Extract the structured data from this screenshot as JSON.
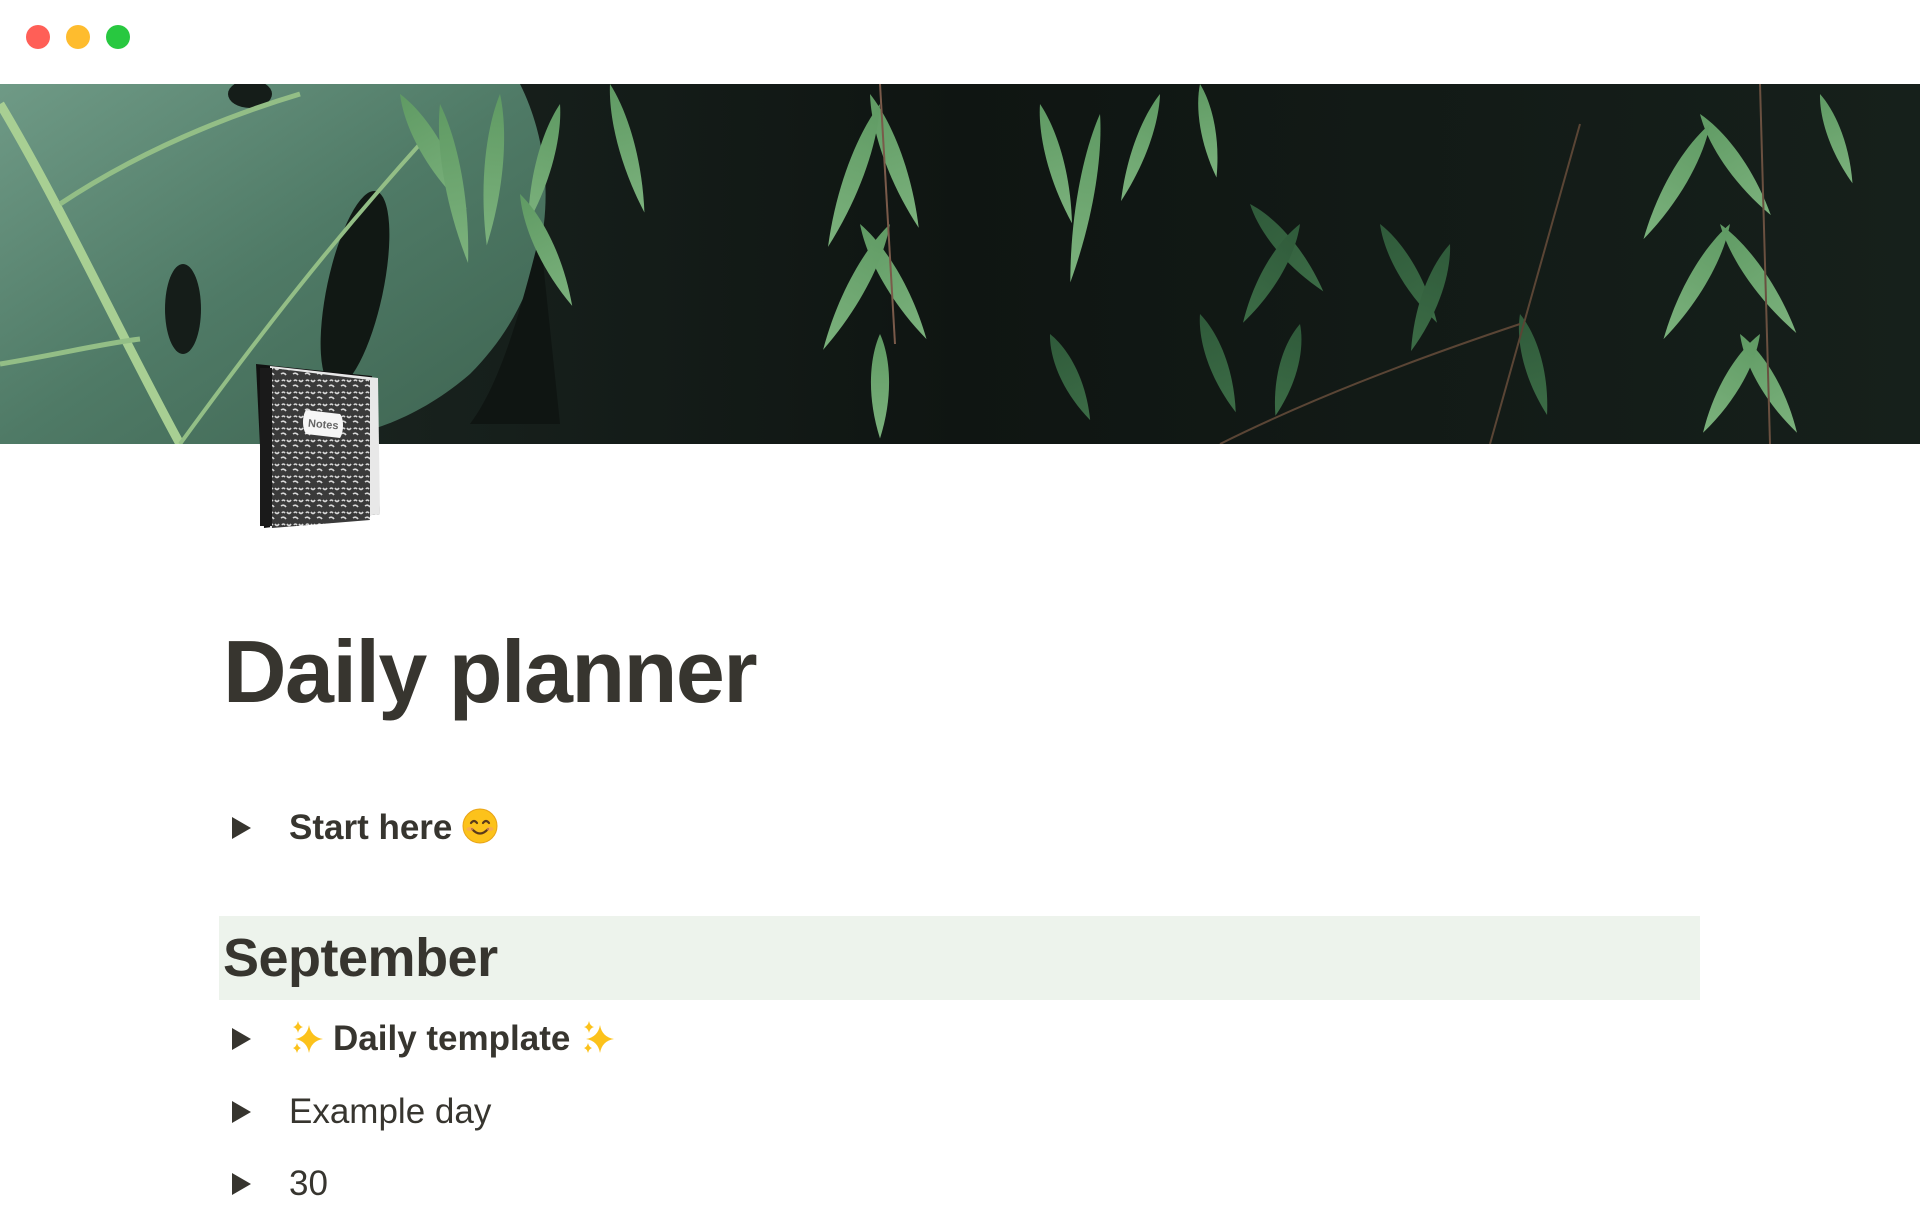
{
  "window": {
    "controls": [
      {
        "name": "close",
        "color": "#ff5f57"
      },
      {
        "name": "minimize",
        "color": "#febc2e"
      },
      {
        "name": "maximize",
        "color": "#28c840"
      }
    ]
  },
  "page": {
    "icon": "composition-notebook",
    "icon_label": "Notes",
    "cover": "green-leaves-photo",
    "title": "Daily planner"
  },
  "blocks": {
    "start_here": {
      "type": "toggle",
      "label": "Start here",
      "emoji": "smiling-face-icon",
      "bold": true
    },
    "september": {
      "type": "heading",
      "text": "September",
      "background": "#edf3ec"
    },
    "toggles": [
      {
        "label": "Daily template",
        "emoji_before": "sparkles-icon",
        "emoji_after": "sparkles-icon",
        "bold": true
      },
      {
        "label": "Example day",
        "bold": false
      },
      {
        "label": "30",
        "bold": false
      }
    ]
  },
  "colors": {
    "text": "#37352f",
    "heading_bg": "#edf3ec"
  }
}
